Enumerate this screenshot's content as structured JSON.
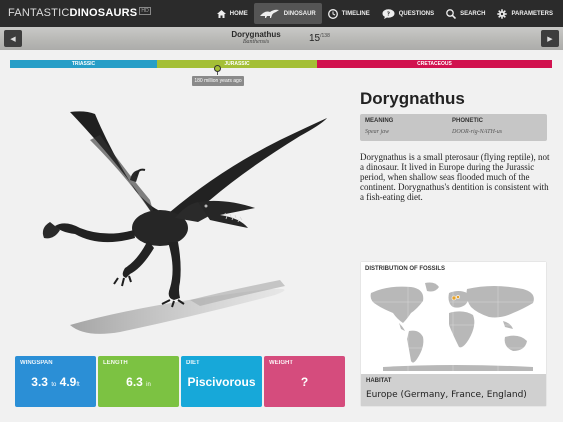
{
  "app": {
    "brand_light": "FANTASTIC",
    "brand_bold": "DINOSAURS",
    "brand_badge": "HD"
  },
  "nav": {
    "home": "HOME",
    "dinosaur": "DINOSAUR",
    "timeline": "TIMELINE",
    "questions": "QUESTIONS",
    "search": "SEARCH",
    "parameters": "PARAMETERS",
    "active": "dinosaur"
  },
  "header": {
    "name": "Dorygnathus",
    "species": "Banthensis",
    "index": "15",
    "total": "/138"
  },
  "timeline": {
    "triassic": "TRIASSIC",
    "jurassic": "JURASSIC",
    "cretaceous": "CRETACEOUS",
    "marker_label": "180 million years ago",
    "colors": {
      "triassic": "#279ec7",
      "jurassic": "#a4bf36",
      "cretaceous": "#d1124f"
    }
  },
  "info": {
    "title": "Dorygnathus",
    "meaning_label": "MEANING",
    "meaning_value": "Spear jaw",
    "phonetic_label": "PHONETIC",
    "phonetic_value": "DOOR-rig-NATH-us",
    "description": "Dorygnathus is a small pterosaur (flying reptile), not a dinosaur. It lived in Europe during the Jurassic period, when shallow seas flooded much of the continent. Dorygnathus's dentition is consistent with a fish-eating diet."
  },
  "fossils": {
    "title": "DISTRIBUTION OF FOSSILS",
    "habitat_label": "HABITAT",
    "habitat_value": "Europe (Germany, France, England)"
  },
  "stats": {
    "wingspan_label": "WINGSPAN",
    "wingspan_min": "3.3",
    "wingspan_to": "to",
    "wingspan_max": "4.9",
    "wingspan_unit": "ft",
    "length_label": "LENGTH",
    "length_value": "6.3",
    "length_unit": "in",
    "diet_label": "DIET",
    "diet_value": "Piscivorous",
    "weight_label": "WEIGHT",
    "weight_value": "?"
  }
}
